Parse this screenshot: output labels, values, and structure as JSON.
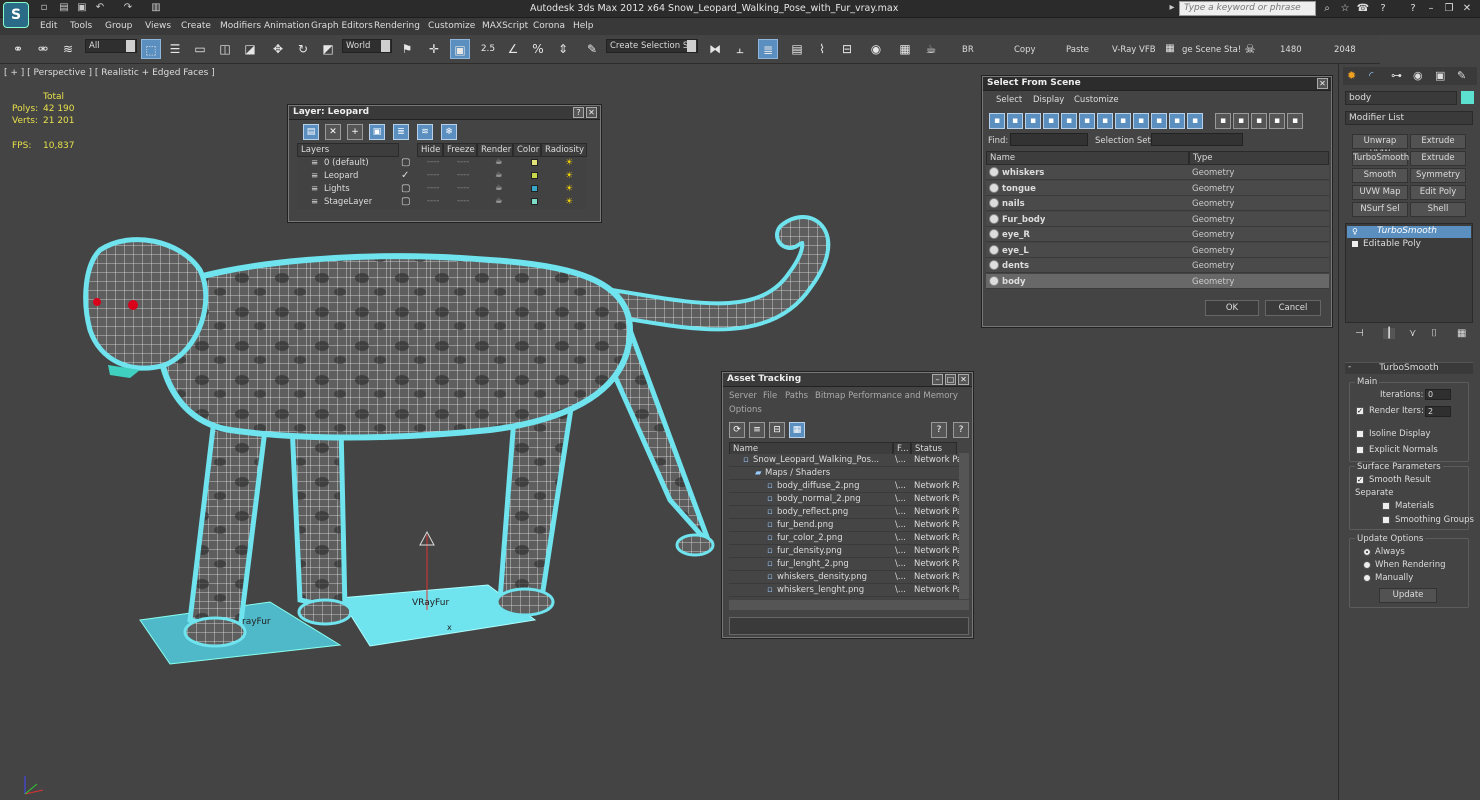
{
  "app": {
    "title": "Autodesk 3ds Max  2012 x64     Snow_Leopard_Walking_Pose_with_Fur_vray.max",
    "search_placeholder": "Type a keyword or phrase",
    "logo": "S"
  },
  "menus": [
    "Edit",
    "Tools",
    "Group",
    "Views",
    "Create",
    "Modifiers",
    "Animation",
    "Graph Editors",
    "Rendering",
    "Customize",
    "MAXScript",
    "Corona",
    "Help"
  ],
  "toolbar": {
    "filter": "All",
    "coord": "World",
    "snap": "2.5",
    "selection_set": "Create Selection Se",
    "br": "BR",
    "copy": "Copy",
    "paste": "Paste",
    "vray": "V-Ray VFB",
    "scene_stat": "ge Scene Sta!",
    "w": "1480",
    "h": "2048"
  },
  "viewport": {
    "label": "[ + ] [ Perspective ] [ Realistic + Edged Faces ]",
    "stats": {
      "header": "Total",
      "polys_label": "Polys:",
      "polys": "42 190",
      "verts_label": "Verts:",
      "verts": "21 201",
      "fps_label": "FPS:",
      "fps": "10,837"
    },
    "labels": {
      "vrayfur_left": "rayFur",
      "vrayfur_right": "VRayFur",
      "axis_x": "x"
    }
  },
  "layer_panel": {
    "title": "Layer: Leopard",
    "headers": [
      "Layers",
      "Hide",
      "Freeze",
      "Render",
      "Color",
      "Radiosity"
    ],
    "rows": [
      {
        "name": "0 (default)",
        "color": "#e2e27a"
      },
      {
        "name": "Leopard",
        "color": "#c8d84a",
        "active": true
      },
      {
        "name": "Lights",
        "color": "#3aa6c8"
      },
      {
        "name": "StageLayer",
        "color": "#7cdcc8"
      }
    ]
  },
  "select_panel": {
    "title": "Select From Scene",
    "menus": [
      "Select",
      "Display",
      "Customize"
    ],
    "find_label": "Find:",
    "selset_label": "Selection Set:",
    "headers": [
      "Name",
      "Type"
    ],
    "rows": [
      {
        "name": "whiskers",
        "type": "Geometry"
      },
      {
        "name": "tongue",
        "type": "Geometry"
      },
      {
        "name": "nails",
        "type": "Geometry"
      },
      {
        "name": "Fur_body",
        "type": "Geometry"
      },
      {
        "name": "eye_R",
        "type": "Geometry"
      },
      {
        "name": "eye_L",
        "type": "Geometry"
      },
      {
        "name": "dents",
        "type": "Geometry"
      },
      {
        "name": "body",
        "type": "Geometry",
        "selected": true
      }
    ],
    "ok": "OK",
    "cancel": "Cancel"
  },
  "asset_panel": {
    "title": "Asset Tracking",
    "menus": [
      "Server",
      "File",
      "Paths",
      "Bitmap Performance and Memory",
      "Options"
    ],
    "headers": [
      "Name",
      "F...",
      "Status"
    ],
    "rows": [
      {
        "name": "Snow_Leopard_Walking_Pos...",
        "f": "\\...",
        "status": "Network Pa",
        "indent": 2
      },
      {
        "name": "Maps / Shaders",
        "f": "",
        "status": "",
        "indent": 3
      },
      {
        "name": "body_diffuse_2.png",
        "f": "\\...",
        "status": "Network Pa",
        "indent": 4
      },
      {
        "name": "body_normal_2.png",
        "f": "\\...",
        "status": "Network Pa",
        "indent": 4
      },
      {
        "name": "body_reflect.png",
        "f": "\\...",
        "status": "Network Pa",
        "indent": 4
      },
      {
        "name": "fur_bend.png",
        "f": "\\...",
        "status": "Network Pa",
        "indent": 4
      },
      {
        "name": "fur_color_2.png",
        "f": "\\...",
        "status": "Network Pa",
        "indent": 4
      },
      {
        "name": "fur_density.png",
        "f": "\\...",
        "status": "Network Pa",
        "indent": 4
      },
      {
        "name": "fur_lenght_2.png",
        "f": "\\...",
        "status": "Network Pa",
        "indent": 4
      },
      {
        "name": "whiskers_density.png",
        "f": "\\...",
        "status": "Network Pa",
        "indent": 4
      },
      {
        "name": "whiskers_lenght.png",
        "f": "\\...",
        "status": "Network Pa",
        "indent": 4
      }
    ]
  },
  "cmd_panel": {
    "object_name": "body",
    "modifier_list": "Modifier List",
    "buttons": [
      "Unwrap UVW",
      "Extrude",
      "TurboSmooth",
      "Extrude",
      "Smooth",
      "Symmetry",
      "UVW Map",
      "Edit Poly",
      "NSurf Sel",
      "Shell"
    ],
    "stack": [
      "TurboSmooth",
      "Editable Poly"
    ],
    "rollout": "TurboSmooth",
    "main": "Main",
    "iterations_label": "Iterations:",
    "iterations": "0",
    "render_iters_label": "Render Iters:",
    "render_iters": "2",
    "isoline": "Isoline Display",
    "explicit": "Explicit Normals",
    "surface": "Surface Parameters",
    "smooth_result": "Smooth Result",
    "separate": "Separate",
    "materials": "Materials",
    "smoothing_groups": "Smoothing Groups",
    "update_options": "Update Options",
    "always": "Always",
    "when_rendering": "When Rendering",
    "manually": "Manually",
    "update": "Update"
  },
  "colors": {
    "accent": "#5a8fbf",
    "fur": "#6fe3ee",
    "eye": "#d8001a"
  }
}
